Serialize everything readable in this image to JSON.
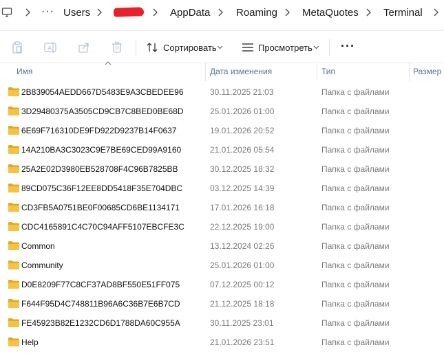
{
  "address": {
    "more": "···",
    "segments": [
      "Users",
      "AppData",
      "Roaming",
      "MetaQuotes",
      "Terminal"
    ]
  },
  "toolbar": {
    "sort_label": "Сортировать",
    "view_label": "Просмотреть",
    "more_label": "···"
  },
  "columns": {
    "name": "Имя",
    "date": "Дата изменения",
    "type": "Тип",
    "size": "Размер"
  },
  "rows": [
    {
      "name": "2B839054AEDD667D5483E9A3CBEDEE96",
      "date": "30.11.2025 21:03",
      "type": "Папка с файлами"
    },
    {
      "name": "3D29480375A3505CD9CB7C8BED0BE68D",
      "date": "25.01.2026 01:00",
      "type": "Папка с файлами"
    },
    {
      "name": "6E69F716310DE9FD922D9237B14F0637",
      "date": "19.01.2026 20:52",
      "type": "Папка с файлами"
    },
    {
      "name": "14A210BA3C3023C9E7BE69CED99A9160",
      "date": "21.01.2026 05:54",
      "type": "Папка с файлами"
    },
    {
      "name": "25A2E02D3980EB528708F4C96B7825BB",
      "date": "30.12.2025 18:32",
      "type": "Папка с файлами"
    },
    {
      "name": "89CD075C36F12EE8DD5418F35E704DBC",
      "date": "03.12.2025 14:39",
      "type": "Папка с файлами"
    },
    {
      "name": "CD3FB5A0751BE0F00685CD6BE1134171",
      "date": "17.01.2026 16:18",
      "type": "Папка с файлами"
    },
    {
      "name": "CDC4165891C4C70C94AFF5107EBCFE3C",
      "date": "22.12.2025 19:00",
      "type": "Папка с файлами"
    },
    {
      "name": "Common",
      "date": "13.12.2024 02:26",
      "type": "Папка с файлами"
    },
    {
      "name": "Community",
      "date": "25.01.2026 01:00",
      "type": "Папка с файлами"
    },
    {
      "name": "D0E8209F77C8CF37AD8BF550E51FF075",
      "date": "07.12.2025 00:12",
      "type": "Папка с файлами"
    },
    {
      "name": "F644F95D4C748811B96A6C36B7E6B7CD",
      "date": "21.12.2025 18:18",
      "type": "Папка с файлами"
    },
    {
      "name": "FE45923B82E1232CD6D1788DA60C955A",
      "date": "30.11.2025 23:01",
      "type": "Папка с файлами"
    },
    {
      "name": "Help",
      "date": "21.01.2026 23:51",
      "type": "Папка с файлами"
    }
  ],
  "colors": {
    "folder": "#f5c242",
    "folder_dark": "#e0a82a",
    "header_text": "#5a6ea0",
    "redaction": "#e8202a"
  }
}
